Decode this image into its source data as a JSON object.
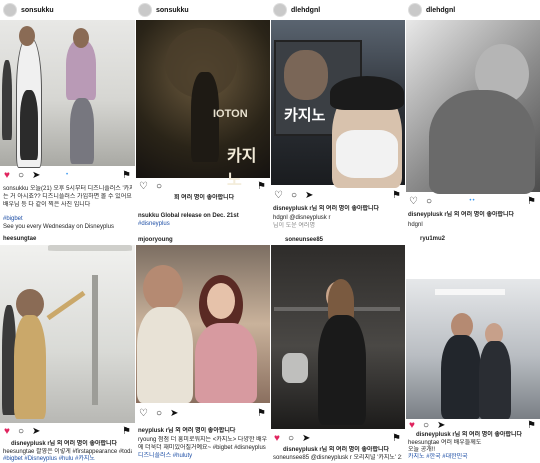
{
  "tiles": [
    {
      "user": "sonsukku",
      "likes": "",
      "caption_lines": [
        "sonsukku 오늘(21) 오후 5시부터 디즈니플러스 '카지노' 8부 공개되",
        "는 거 아시죠?? 디즈니플러스 가입하면 볼 수 있어요 감독님이랑",
        "배우님 등 다 같이 찍은 사진 입니다",
        "",
        "#bigbet",
        "See you every Wednesday on Disneyplus"
      ],
      "commenter": "heesungtae"
    },
    {
      "user": "sonsukku",
      "poster_title": "카지노",
      "poster_top": "IOTON",
      "likes": "회 여러 명이 좋아합니다",
      "caption_lines": [
        "nsukku Global release on Dec. 21st",
        "#disneyplus",
        "mjooryoung"
      ],
      "commenter": ""
    },
    {
      "user": "dlehdgnl",
      "board_text": "카지노",
      "likes": "",
      "caption_lines": [
        "disneyplusk r님 외 여러 명이 좋아합니다",
        "hdgnl @disneyplusk r",
        "님이 도운 여러명"
      ],
      "commenter": "soneunsee85"
    },
    {
      "user": "dlehdgnl",
      "likes": "",
      "caption_lines": [
        "disneyplusk r님 외 여러 명이 좋아합니다",
        "hdgnl"
      ],
      "commenter": "ryu1mu2"
    },
    {
      "user": "",
      "likes": "disneyplusk r님 외 여러 명이 좋아합니다",
      "caption_lines": [
        "heesungtae 촬영은 이렇게 #firstappearance #today #h",
        "#bigbet #Disneyplus #hulu #카지노"
      ],
      "commenter": ""
    },
    {
      "user": "",
      "likes": "neyplusk r님 외 여러 명이 좋아합니다",
      "caption_lines": [
        "ryoung 점점 더 흥미로워지는 <카지노> 다양한 배우들",
        "에 더욱더 재미있어질거예요~ #bigbet #disneyplus",
        "디즈니플러스 #huluty"
      ],
      "commenter": ""
    },
    {
      "user": "",
      "likes": "disneyplusk r님 외 여러 명이 좋아합니다",
      "caption_lines": [
        "soneunsee85 @disneyplusk r 오리지널 '카지노' 21일 공개"
      ],
      "commenter": ""
    },
    {
      "user": "",
      "likes": "disneyplusk r님 외 여러 명이 좋아합니다",
      "caption_lines": [
        "heesungtae 여러 배우들께도",
        "오늘 공개!!",
        "카지노 #한국 #대한민국"
      ],
      "commenter": ""
    }
  ]
}
